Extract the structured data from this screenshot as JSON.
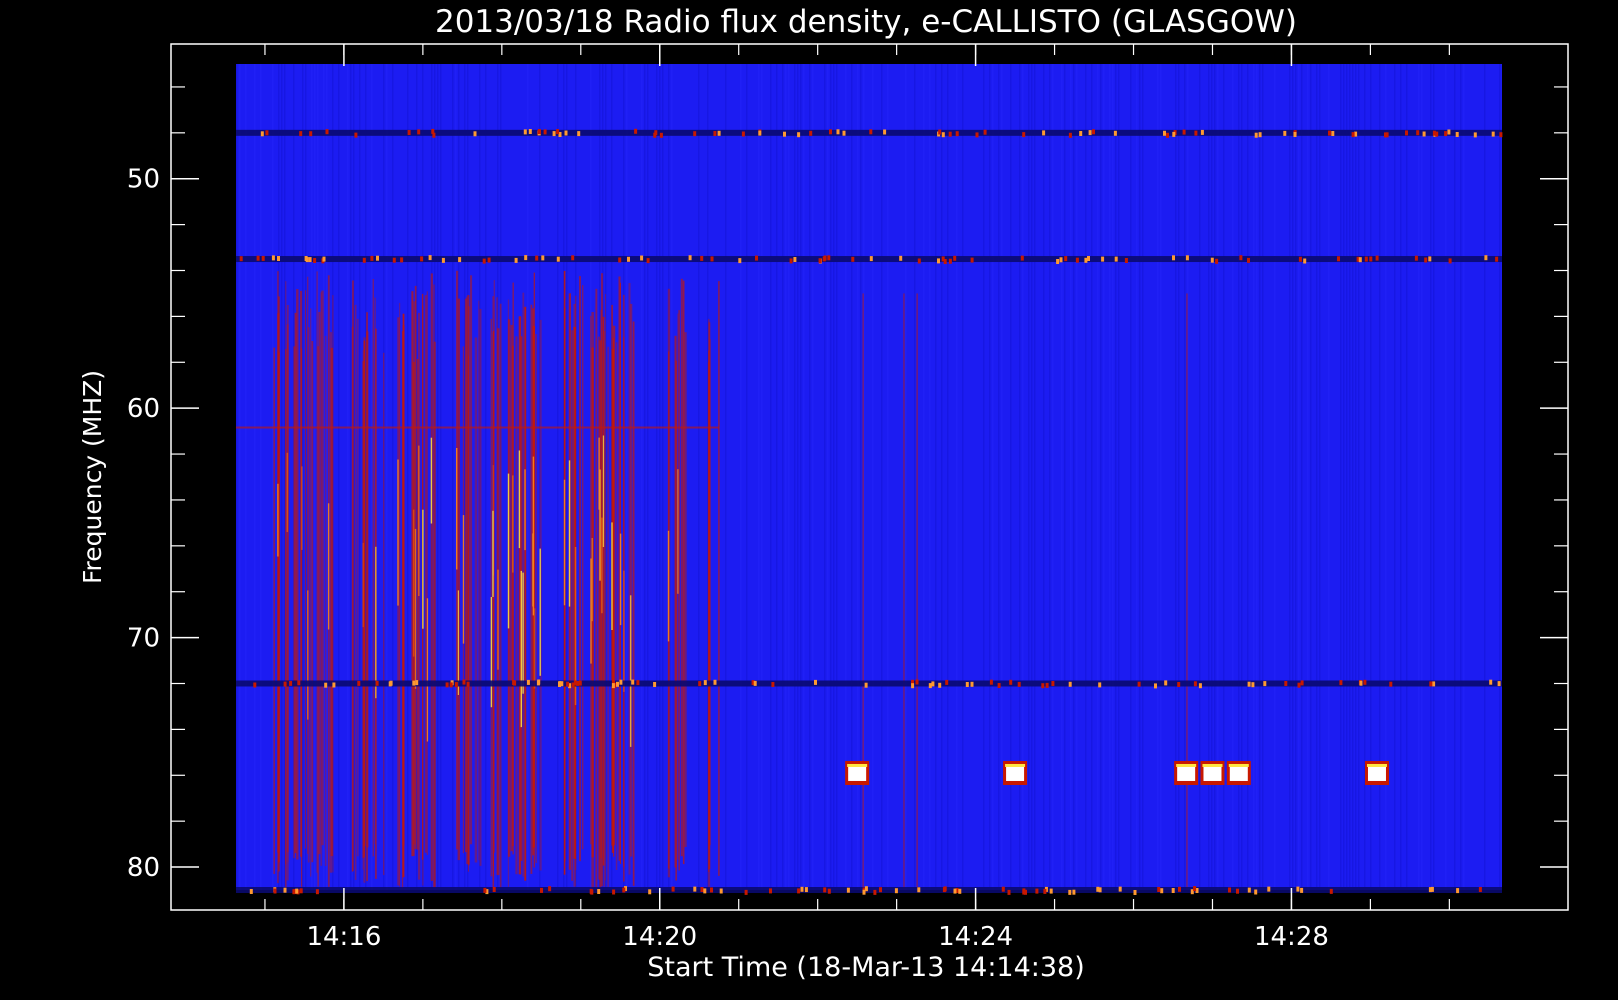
{
  "chart_data": {
    "type": "heatmap",
    "title": "2013/03/18  Radio flux density, e-CALLISTO (GLASGOW)",
    "xlabel": "Start Time (18-Mar-13 14:14:38)",
    "ylabel": "Frequency (MHZ)",
    "x_ticks": [
      "14:16",
      "14:20",
      "14:24",
      "14:28"
    ],
    "y_ticks": [
      50,
      60,
      70,
      80
    ],
    "x_range": [
      "14:14:38",
      "14:30:40"
    ],
    "y_range_mhz": [
      45,
      81
    ],
    "y_axis_inverted": true,
    "colormap": "blue-red-yellow-white",
    "colors": {
      "background": "#000000",
      "low": "#1c1cf2",
      "mid": "#c81800",
      "high": "#ffe640",
      "peak": "#ffffff"
    },
    "features": {
      "type_iii_bursts_interval": [
        "14:15:00",
        "14:20:45"
      ],
      "interference_lines_mhz": [
        48,
        53.5,
        72,
        81
      ],
      "bright_spots_mhz": 75.9,
      "bright_spot_times": [
        "14:22:30",
        "14:24:30",
        "14:26:40",
        "14:27:00",
        "14:27:20",
        "14:29:05"
      ]
    }
  }
}
